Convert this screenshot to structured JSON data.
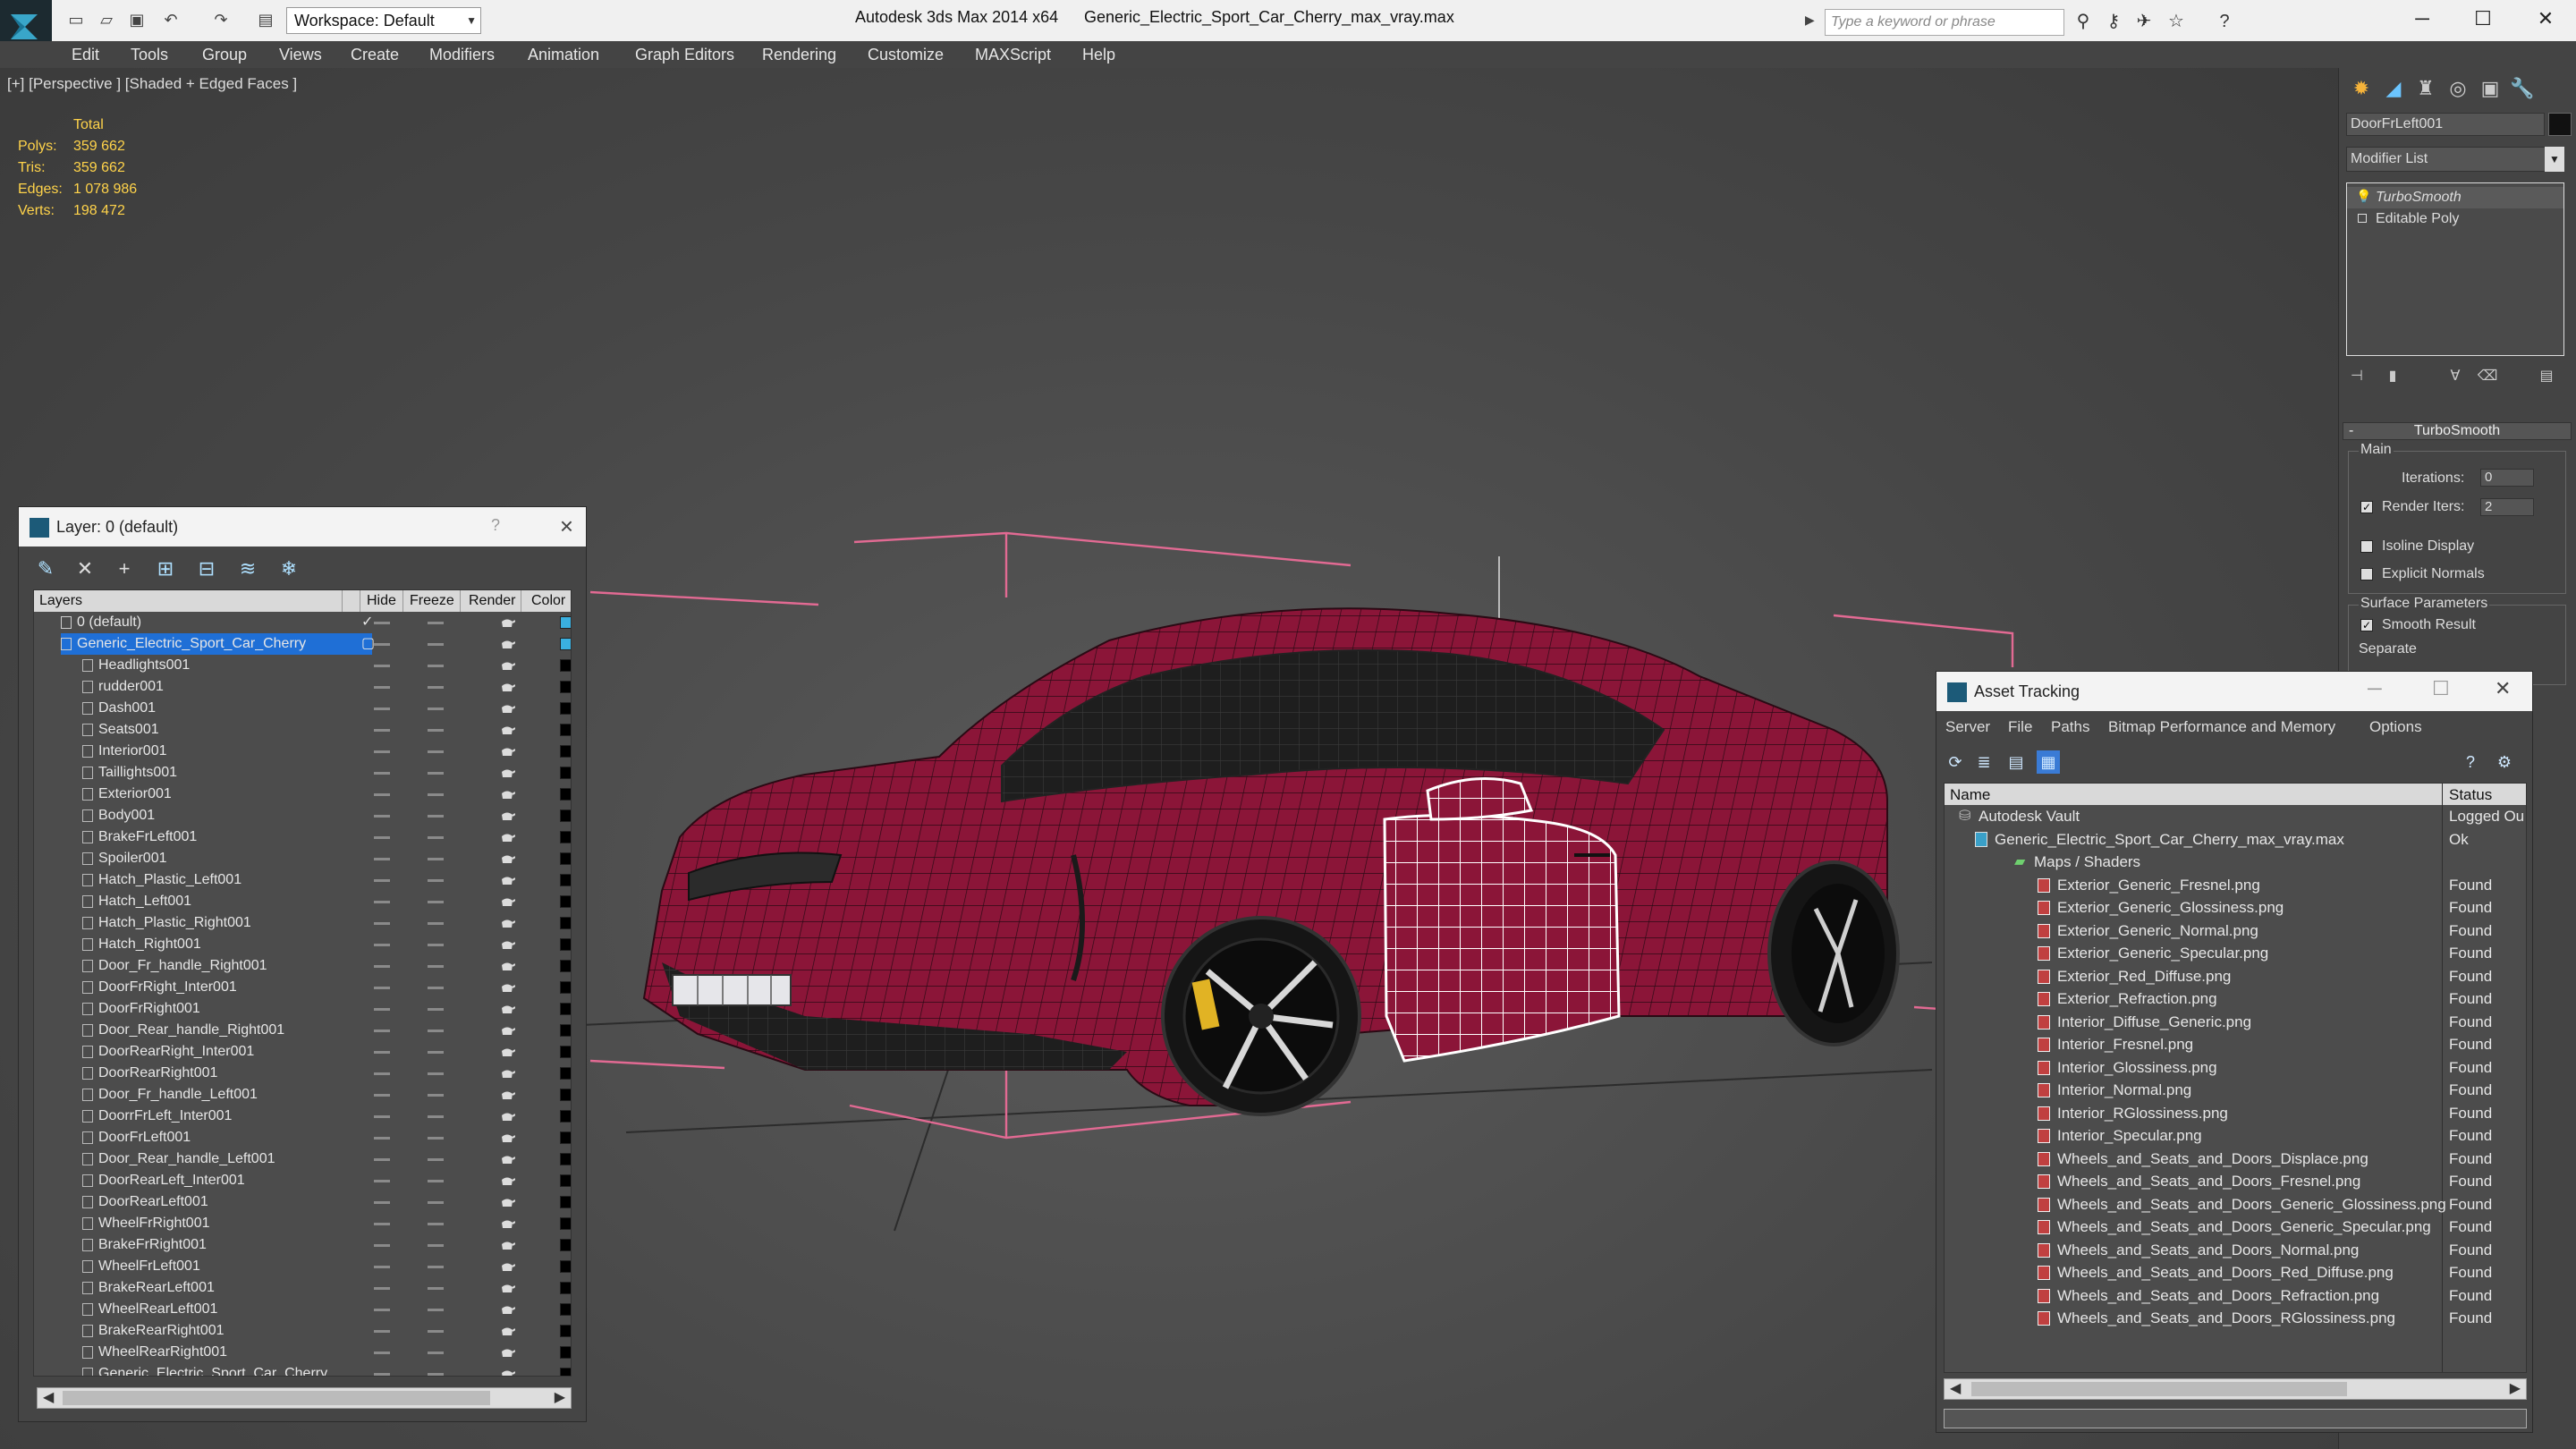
{
  "titlebar": {
    "workspace": "Workspace: Default",
    "app_title": "Autodesk 3ds Max  2014 x64",
    "file_title": "Generic_Electric_Sport_Car_Cherry_max_vray.max",
    "search_placeholder": "Type a keyword or phrase",
    "quick_access_icons": [
      "new-icon",
      "open-icon",
      "save-icon",
      "undo-icon",
      "redo-icon",
      "project-folder-icon"
    ],
    "right_icons": [
      "binoculars-icon",
      "key-icon",
      "satellite-icon",
      "star-icon",
      "help-icon"
    ]
  },
  "menu": [
    "Edit",
    "Tools",
    "Group",
    "Views",
    "Create",
    "Modifiers",
    "Animation",
    "Graph Editors",
    "Rendering",
    "Customize",
    "MAXScript",
    "Help"
  ],
  "viewport": {
    "label": "[+] [Perspective ] [Shaded + Edged Faces ]",
    "stats": {
      "header": "Total",
      "rows": [
        {
          "label": "Polys:",
          "value": "359 662"
        },
        {
          "label": "Tris:",
          "value": "359 662"
        },
        {
          "label": "Edges:",
          "value": "1 078 986"
        },
        {
          "label": "Verts:",
          "value": "198 472"
        }
      ]
    },
    "car_color": "#8b1538",
    "wire_color": "#2a0a14",
    "bbox_color": "#e26a93"
  },
  "layer_panel": {
    "title": "Layer: 0 (default)",
    "help": "?",
    "toolbar_icons": [
      "new-layer-icon",
      "delete-layer-icon",
      "add-selection-icon",
      "select-objects-icon",
      "highlight-icon",
      "hide-all-icon",
      "freeze-all-icon"
    ],
    "columns": {
      "layers": "Layers",
      "hide": "Hide",
      "freeze": "Freeze",
      "render": "Render",
      "color": "Color"
    },
    "rows": [
      {
        "name": "0 (default)",
        "level": 0,
        "type": "layer",
        "swatch": "#3ab0e0"
      },
      {
        "name": "Generic_Electric_Sport_Car_Cherry",
        "level": 0,
        "type": "layer",
        "selected": true,
        "swatch": "#3ab0e0"
      },
      {
        "name": "Headlights001",
        "level": 1,
        "type": "object"
      },
      {
        "name": "rudder001",
        "level": 1,
        "type": "object"
      },
      {
        "name": "Dash001",
        "level": 1,
        "type": "object"
      },
      {
        "name": "Seats001",
        "level": 1,
        "type": "object"
      },
      {
        "name": "Interior001",
        "level": 1,
        "type": "object"
      },
      {
        "name": "Taillights001",
        "level": 1,
        "type": "object"
      },
      {
        "name": "Exterior001",
        "level": 1,
        "type": "object"
      },
      {
        "name": "Body001",
        "level": 1,
        "type": "object"
      },
      {
        "name": "BrakeFrLeft001",
        "level": 1,
        "type": "object"
      },
      {
        "name": "Spoiler001",
        "level": 1,
        "type": "object"
      },
      {
        "name": "Hatch_Plastic_Left001",
        "level": 1,
        "type": "object"
      },
      {
        "name": "Hatch_Left001",
        "level": 1,
        "type": "object"
      },
      {
        "name": "Hatch_Plastic_Right001",
        "level": 1,
        "type": "object"
      },
      {
        "name": "Hatch_Right001",
        "level": 1,
        "type": "object"
      },
      {
        "name": "Door_Fr_handle_Right001",
        "level": 1,
        "type": "object"
      },
      {
        "name": "DoorFrRight_Inter001",
        "level": 1,
        "type": "object"
      },
      {
        "name": "DoorFrRight001",
        "level": 1,
        "type": "object"
      },
      {
        "name": "Door_Rear_handle_Right001",
        "level": 1,
        "type": "object"
      },
      {
        "name": "DoorRearRight_Inter001",
        "level": 1,
        "type": "object"
      },
      {
        "name": "DoorRearRight001",
        "level": 1,
        "type": "object"
      },
      {
        "name": "Door_Fr_handle_Left001",
        "level": 1,
        "type": "object"
      },
      {
        "name": "DoorrFrLeft_Inter001",
        "level": 1,
        "type": "object"
      },
      {
        "name": "DoorFrLeft001",
        "level": 1,
        "type": "object"
      },
      {
        "name": "Door_Rear_handle_Left001",
        "level": 1,
        "type": "object"
      },
      {
        "name": "DoorRearLeft_Inter001",
        "level": 1,
        "type": "object"
      },
      {
        "name": "DoorRearLeft001",
        "level": 1,
        "type": "object"
      },
      {
        "name": "WheelFrRight001",
        "level": 1,
        "type": "object"
      },
      {
        "name": "BrakeFrRight001",
        "level": 1,
        "type": "object"
      },
      {
        "name": "WheelFrLeft001",
        "level": 1,
        "type": "object"
      },
      {
        "name": "BrakeRearLeft001",
        "level": 1,
        "type": "object"
      },
      {
        "name": "WheelRearLeft001",
        "level": 1,
        "type": "object"
      },
      {
        "name": "BrakeRearRight001",
        "level": 1,
        "type": "object"
      },
      {
        "name": "WheelRearRight001",
        "level": 1,
        "type": "object"
      },
      {
        "name": "Generic_Electric_Sport_Car_Cherry",
        "level": 1,
        "type": "object"
      }
    ]
  },
  "command_panel": {
    "tabs": [
      "create-icon",
      "modify-icon",
      "hierarchy-icon",
      "motion-icon",
      "display-icon",
      "utilities-icon"
    ],
    "object_name": "DoorFrLeft001",
    "modifier_list": "Modifier List",
    "stack": [
      "TurboSmooth",
      "Editable Poly"
    ],
    "stack_tools": [
      "pin-stack-icon",
      "show-end-result-icon",
      "make-unique-icon",
      "remove-modifier-icon",
      "configure-sets-icon"
    ],
    "rollout_title": "TurboSmooth",
    "main_group": "Main",
    "iterations_label": "Iterations:",
    "iterations_value": "0",
    "render_iters_label": "Render Iters:",
    "render_iters_value": "2",
    "isoline_label": "Isoline Display",
    "explicit_label": "Explicit Normals",
    "surface_group": "Surface Parameters",
    "smooth_result_label": "Smooth Result",
    "separate_label": "Separate"
  },
  "asset_panel": {
    "title": "Asset Tracking",
    "menu": [
      "Server",
      "File",
      "Paths",
      "Bitmap Performance and Memory",
      "Options"
    ],
    "toolbar_icons": [
      "refresh-icon",
      "list-view-icon",
      "table-view-icon",
      "grid-view-icon"
    ],
    "right_icons": [
      "vault-help-icon",
      "vault-settings-icon"
    ],
    "columns": {
      "name": "Name",
      "status": "Status"
    },
    "rows": [
      {
        "name": "Autodesk Vault",
        "status": "Logged Ou",
        "level": 0,
        "type": "vault"
      },
      {
        "name": "Generic_Electric_Sport_Car_Cherry_max_vray.max",
        "status": "Ok",
        "level": 1,
        "type": "max"
      },
      {
        "name": "Maps / Shaders",
        "status": "",
        "level": 2,
        "type": "folder"
      },
      {
        "name": "Exterior_Generic_Fresnel.png",
        "status": "Found",
        "level": 3,
        "type": "file"
      },
      {
        "name": "Exterior_Generic_Glossiness.png",
        "status": "Found",
        "level": 3,
        "type": "file"
      },
      {
        "name": "Exterior_Generic_Normal.png",
        "status": "Found",
        "level": 3,
        "type": "file"
      },
      {
        "name": "Exterior_Generic_Specular.png",
        "status": "Found",
        "level": 3,
        "type": "file"
      },
      {
        "name": "Exterior_Red_Diffuse.png",
        "status": "Found",
        "level": 3,
        "type": "file"
      },
      {
        "name": "Exterior_Refraction.png",
        "status": "Found",
        "level": 3,
        "type": "file"
      },
      {
        "name": "Interior_Diffuse_Generic.png",
        "status": "Found",
        "level": 3,
        "type": "file"
      },
      {
        "name": "Interior_Fresnel.png",
        "status": "Found",
        "level": 3,
        "type": "file"
      },
      {
        "name": "Interior_Glossiness.png",
        "status": "Found",
        "level": 3,
        "type": "file"
      },
      {
        "name": "Interior_Normal.png",
        "status": "Found",
        "level": 3,
        "type": "file"
      },
      {
        "name": "Interior_RGlossiness.png",
        "status": "Found",
        "level": 3,
        "type": "file"
      },
      {
        "name": "Interior_Specular.png",
        "status": "Found",
        "level": 3,
        "type": "file"
      },
      {
        "name": "Wheels_and_Seats_and_Doors_Displace.png",
        "status": "Found",
        "level": 3,
        "type": "file"
      },
      {
        "name": "Wheels_and_Seats_and_Doors_Fresnel.png",
        "status": "Found",
        "level": 3,
        "type": "file"
      },
      {
        "name": "Wheels_and_Seats_and_Doors_Generic_Glossiness.png",
        "status": "Found",
        "level": 3,
        "type": "file"
      },
      {
        "name": "Wheels_and_Seats_and_Doors_Generic_Specular.png",
        "status": "Found",
        "level": 3,
        "type": "file"
      },
      {
        "name": "Wheels_and_Seats_and_Doors_Normal.png",
        "status": "Found",
        "level": 3,
        "type": "file"
      },
      {
        "name": "Wheels_and_Seats_and_Doors_Red_Diffuse.png",
        "status": "Found",
        "level": 3,
        "type": "file"
      },
      {
        "name": "Wheels_and_Seats_and_Doors_Refraction.png",
        "status": "Found",
        "level": 3,
        "type": "file"
      },
      {
        "name": "Wheels_and_Seats_and_Doors_RGlossiness.png",
        "status": "Found",
        "level": 3,
        "type": "file"
      }
    ]
  }
}
